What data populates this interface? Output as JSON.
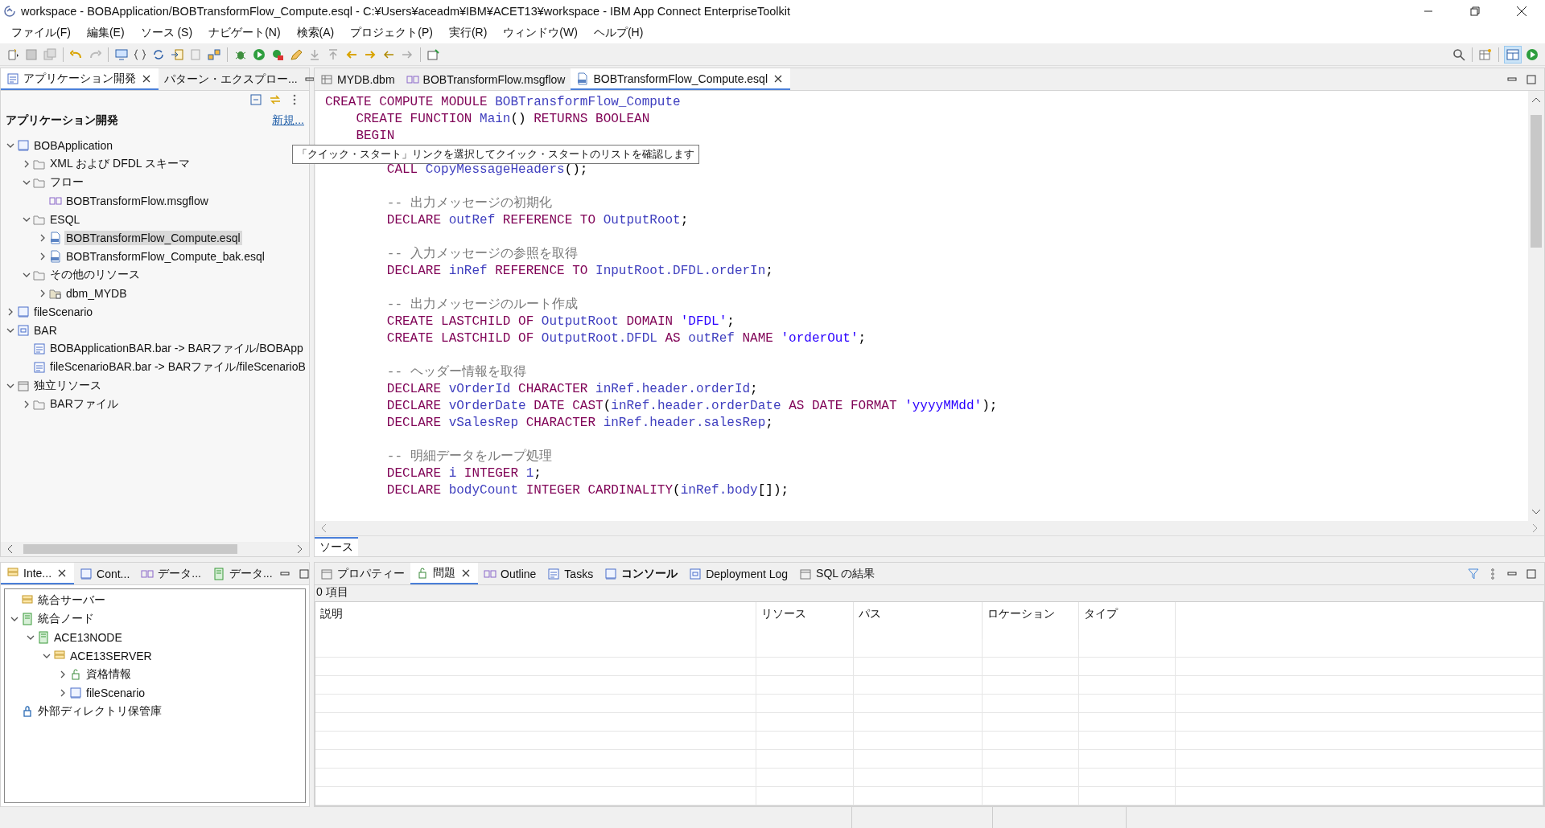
{
  "window": {
    "title": "workspace - BOBApplication/BOBTransformFlow_Compute.esql - C:¥Users¥aceadm¥IBM¥ACET13¥workspace - IBM App Connect EnterpriseToolkit"
  },
  "menu": [
    "ファイル(F)",
    "編集(E)",
    "ソース (S)",
    "ナビゲート(N)",
    "検索(A)",
    "プロジェクト(P)",
    "実行(R)",
    "ウィンドウ(W)",
    "ヘルプ(H)"
  ],
  "app_panel": {
    "tabs": [
      {
        "label": "アプリケーション開発",
        "selected": true,
        "closable": true
      },
      {
        "label": "パターン・エクスプロー...",
        "selected": false,
        "closable": false
      }
    ],
    "heading": "アプリケーション開発",
    "new_link": "新規...",
    "tree": [
      {
        "label": "BOBApplication",
        "kind": "application",
        "expanded": true,
        "selected": false,
        "children": [
          {
            "label": "XML および DFDL スキーマ",
            "kind": "schema-folder",
            "expanded": false,
            "selected": false
          },
          {
            "label": "フロー",
            "kind": "flow-folder",
            "expanded": true,
            "selected": false,
            "children": [
              {
                "label": "BOBTransformFlow.msgflow",
                "kind": "flow",
                "selected": false
              }
            ]
          },
          {
            "label": "ESQL",
            "kind": "esql-folder",
            "expanded": true,
            "selected": false,
            "children": [
              {
                "label": "BOBTransformFlow_Compute.esql",
                "kind": "esql",
                "expanded": false,
                "selected": true
              },
              {
                "label": "BOBTransformFlow_Compute_bak.esql",
                "kind": "esql",
                "expanded": false,
                "selected": false
              }
            ]
          },
          {
            "label": "その他のリソース",
            "kind": "folder",
            "expanded": true,
            "selected": false,
            "children": [
              {
                "label": "dbm_MYDB",
                "kind": "database-folder",
                "expanded": false,
                "selected": false
              }
            ]
          }
        ]
      },
      {
        "label": "fileScenario",
        "kind": "application",
        "expanded": false,
        "selected": false
      },
      {
        "label": "BAR",
        "kind": "bar-project",
        "expanded": true,
        "selected": false,
        "children": [
          {
            "label": "BOBApplicationBAR.bar -> BARファイル/BOBApp",
            "kind": "bar-file",
            "selected": false
          },
          {
            "label": "fileScenarioBAR.bar -> BARファイル/fileScenarioB",
            "kind": "bar-file",
            "selected": false
          }
        ]
      },
      {
        "label": "独立リソース",
        "kind": "resources",
        "expanded": true,
        "selected": false,
        "children": [
          {
            "label": "BARファイル",
            "kind": "schema-folder",
            "expanded": false,
            "selected": false
          }
        ]
      }
    ]
  },
  "editor": {
    "tabs": [
      {
        "label": "MYDB.dbm",
        "kind": "dbm",
        "selected": false,
        "closable": false
      },
      {
        "label": "BOBTransformFlow.msgflow",
        "kind": "flow",
        "selected": false,
        "closable": false
      },
      {
        "label": "BOBTransformFlow_Compute.esql",
        "kind": "esql",
        "selected": true,
        "closable": true
      }
    ],
    "lines": [
      {
        "kind": "code",
        "segments": [
          {
            "t": "CREATE COMPUTE MODULE ",
            "kind": "kw"
          },
          {
            "t": "BOBTransformFlow_Compute",
            "kind": "id"
          }
        ]
      },
      {
        "kind": "code",
        "segments": [
          {
            "t": "    CREATE FUNCTION ",
            "kind": "kw"
          },
          {
            "t": "Main",
            "kind": "id"
          },
          {
            "t": "() ",
            "kind": "plain"
          },
          {
            "t": "RETURNS BOOLEAN",
            "kind": "kw"
          }
        ]
      },
      {
        "kind": "code",
        "segments": [
          {
            "t": "    BEGIN",
            "kind": "kw"
          }
        ]
      },
      {
        "kind": "blank"
      },
      {
        "kind": "code",
        "segments": [
          {
            "t": "        CALL ",
            "kind": "kw"
          },
          {
            "t": "CopyMessageHeaders",
            "kind": "id"
          },
          {
            "t": "();",
            "kind": "plain"
          }
        ]
      },
      {
        "kind": "blank"
      },
      {
        "kind": "code",
        "segments": [
          {
            "t": "        -- 出力メッセージの初期化",
            "kind": "cm"
          }
        ]
      },
      {
        "kind": "code",
        "segments": [
          {
            "t": "        DECLARE ",
            "kind": "kw"
          },
          {
            "t": "outRef ",
            "kind": "id"
          },
          {
            "t": "REFERENCE TO ",
            "kind": "kw"
          },
          {
            "t": "OutputRoot",
            "kind": "id"
          },
          {
            "t": ";",
            "kind": "plain"
          }
        ]
      },
      {
        "kind": "blank"
      },
      {
        "kind": "code",
        "segments": [
          {
            "t": "        -- 入力メッセージの参照を取得",
            "kind": "cm"
          }
        ]
      },
      {
        "kind": "code",
        "segments": [
          {
            "t": "        DECLARE ",
            "kind": "kw"
          },
          {
            "t": "inRef ",
            "kind": "id"
          },
          {
            "t": "REFERENCE TO ",
            "kind": "kw"
          },
          {
            "t": "InputRoot.DFDL.orderIn",
            "kind": "id"
          },
          {
            "t": ";",
            "kind": "plain"
          }
        ]
      },
      {
        "kind": "blank"
      },
      {
        "kind": "code",
        "segments": [
          {
            "t": "        -- 出力メッセージのルート作成",
            "kind": "cm"
          }
        ]
      },
      {
        "kind": "code",
        "segments": [
          {
            "t": "        CREATE LASTCHILD OF ",
            "kind": "kw"
          },
          {
            "t": "OutputRoot ",
            "kind": "id"
          },
          {
            "t": "DOMAIN ",
            "kind": "kw"
          },
          {
            "t": "'DFDL'",
            "kind": "str"
          },
          {
            "t": ";",
            "kind": "plain"
          }
        ]
      },
      {
        "kind": "code",
        "segments": [
          {
            "t": "        CREATE LASTCHILD OF ",
            "kind": "kw"
          },
          {
            "t": "OutputRoot.DFDL ",
            "kind": "id"
          },
          {
            "t": "AS ",
            "kind": "kw"
          },
          {
            "t": "outRef ",
            "kind": "id"
          },
          {
            "t": "NAME ",
            "kind": "kw"
          },
          {
            "t": "'orderOut'",
            "kind": "str"
          },
          {
            "t": ";",
            "kind": "plain"
          }
        ]
      },
      {
        "kind": "blank"
      },
      {
        "kind": "code",
        "segments": [
          {
            "t": "        -- ヘッダー情報を取得",
            "kind": "cm"
          }
        ]
      },
      {
        "kind": "code",
        "segments": [
          {
            "t": "        DECLARE ",
            "kind": "kw"
          },
          {
            "t": "vOrderId ",
            "kind": "id"
          },
          {
            "t": "CHARACTER ",
            "kind": "kw"
          },
          {
            "t": "inRef.header.orderId",
            "kind": "id"
          },
          {
            "t": ";",
            "kind": "plain"
          }
        ]
      },
      {
        "kind": "code",
        "segments": [
          {
            "t": "        DECLARE ",
            "kind": "kw"
          },
          {
            "t": "vOrderDate ",
            "kind": "id"
          },
          {
            "t": "DATE CAST",
            "kind": "kw"
          },
          {
            "t": "(",
            "kind": "plain"
          },
          {
            "t": "inRef.header.orderDate ",
            "kind": "id"
          },
          {
            "t": "AS DATE FORMAT ",
            "kind": "kw"
          },
          {
            "t": "'yyyyMMdd'",
            "kind": "str"
          },
          {
            "t": ");",
            "kind": "plain"
          }
        ]
      },
      {
        "kind": "code",
        "segments": [
          {
            "t": "        DECLARE ",
            "kind": "kw"
          },
          {
            "t": "vSalesRep ",
            "kind": "id"
          },
          {
            "t": "CHARACTER ",
            "kind": "kw"
          },
          {
            "t": "inRef.header.salesRep",
            "kind": "id"
          },
          {
            "t": ";",
            "kind": "plain"
          }
        ]
      },
      {
        "kind": "blank"
      },
      {
        "kind": "code",
        "segments": [
          {
            "t": "        -- 明細データをループ処理",
            "kind": "cm"
          }
        ]
      },
      {
        "kind": "code",
        "segments": [
          {
            "t": "        DECLARE ",
            "kind": "kw"
          },
          {
            "t": "i ",
            "kind": "id"
          },
          {
            "t": "INTEGER ",
            "kind": "kw"
          },
          {
            "t": "1",
            "kind": "id"
          },
          {
            "t": ";",
            "kind": "plain"
          }
        ]
      },
      {
        "kind": "code",
        "segments": [
          {
            "t": "        DECLARE ",
            "kind": "kw"
          },
          {
            "t": "bodyCount ",
            "kind": "id"
          },
          {
            "t": "INTEGER CARDINALITY",
            "kind": "kw"
          },
          {
            "t": "(",
            "kind": "plain"
          },
          {
            "t": "inRef.body",
            "kind": "id"
          },
          {
            "t": "[]);",
            "kind": "plain"
          }
        ]
      }
    ],
    "tooltip": "「クイック・スタート」リンクを選択してクイック・スタートのリストを確認します",
    "source_tab": "ソース"
  },
  "servers_panel": {
    "tabs": [
      {
        "label": "Inte...",
        "selected": true,
        "closable": true
      },
      {
        "label": "Cont...",
        "selected": false,
        "closable": false
      },
      {
        "label": "データ...",
        "selected": false,
        "closable": false
      },
      {
        "label": "データ...",
        "selected": false,
        "closable": false
      }
    ],
    "tree": [
      {
        "label": "統合サーバー",
        "kind": "server",
        "selected": false
      },
      {
        "label": "統合ノード",
        "kind": "node",
        "expanded": true,
        "selected": false,
        "children": [
          {
            "label": "ACE13NODE",
            "kind": "node",
            "expanded": true,
            "selected": false,
            "children": [
              {
                "label": "ACE13SERVER",
                "kind": "server",
                "expanded": true,
                "selected": false,
                "children": [
                  {
                    "label": "資格情報",
                    "kind": "credentials",
                    "expanded": false,
                    "selected": false
                  },
                  {
                    "label": "fileScenario",
                    "kind": "application",
                    "expanded": false,
                    "selected": false
                  }
                ]
              }
            ]
          }
        ]
      },
      {
        "label": "外部ディレクトリ保管庫",
        "kind": "vault",
        "selected": false
      }
    ]
  },
  "problems_panel": {
    "tabs": [
      {
        "label": "プロパティー",
        "selected": false,
        "closable": false,
        "has_updates": false
      },
      {
        "label": "問題",
        "selected": true,
        "closable": true,
        "has_updates": false
      },
      {
        "label": "Outline",
        "selected": false,
        "closable": false,
        "has_updates": false
      },
      {
        "label": "Tasks",
        "selected": false,
        "closable": false,
        "has_updates": false
      },
      {
        "label": "コンソール",
        "selected": false,
        "closable": false,
        "has_updates": true
      },
      {
        "label": "Deployment Log",
        "selected": false,
        "closable": false,
        "has_updates": false
      },
      {
        "label": "SQL の結果",
        "selected": false,
        "closable": false,
        "has_updates": false
      }
    ],
    "count": "0 項目",
    "columns": [
      "説明",
      "リソース",
      "パス",
      "ロケーション",
      "タイプ"
    ]
  }
}
